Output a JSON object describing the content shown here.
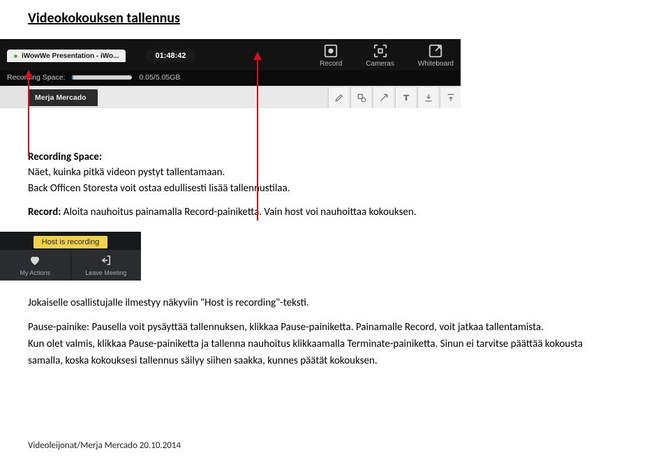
{
  "title": "Videokokouksen tallennus",
  "screenshot1": {
    "tab_title": "iWowWe Presentation - iWo...",
    "duration": "01:48:42",
    "controls": {
      "record": "Record",
      "cameras": "Cameras",
      "whiteboard": "Whiteboard"
    },
    "recording_space_label": "Recording Space:",
    "recording_space_value": "0.05/5.05GB",
    "user_name": "Merja Mercado"
  },
  "section1": {
    "heading": "Recording Space:",
    "line1": "Näet, kuinka pitkä videon pystyt tallentamaan.",
    "line2": "Back Officen Storesta voit ostaa edullisesti lisää tallennustilaa.",
    "record_label": "Record:  ",
    "record_text": "Aloita nauhoitus painamalla Record-painiketta. Vain host voi nauhoittaa kokouksen."
  },
  "screenshot2": {
    "badge": "Host is recording",
    "my_actions": "My Actions",
    "leave_meeting": "Leave Meeting"
  },
  "section2": {
    "line1": "Jokaiselle osallistujalle ilmestyy näkyviin \"Host is recording\"-teksti.",
    "line2a": "Pause-painike: ",
    "line2b": "Pausella voit pysäyttää tallennuksen, klikkaa Pause-painiketta. Painamalle Record, voit jatkaa tallentamista.",
    "line3": "Kun olet valmis, klikkaa Pause-painiketta ja tallenna nauhoitus klikkaamalla  Terminate-painiketta. Sinun ei tarvitse päättää kokousta",
    "line4": "samalla, koska kokouksesi tallennus säilyy siihen saakka, kunnes päätät kokouksen."
  },
  "footer": "Videoleijonat/Merja Mercado 20.10.2014"
}
